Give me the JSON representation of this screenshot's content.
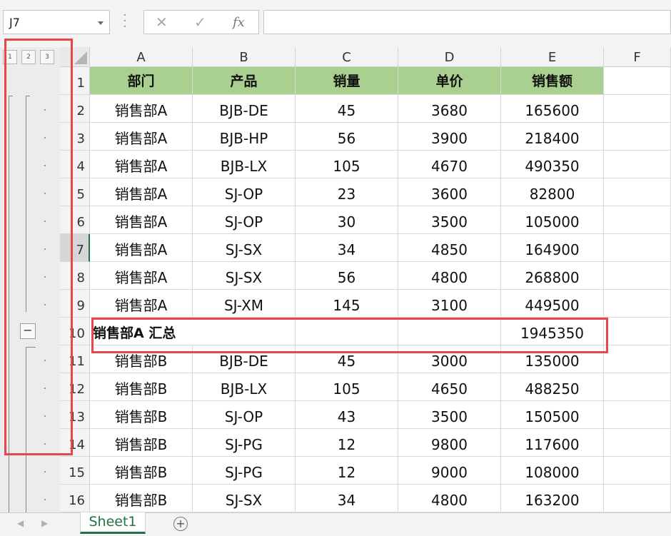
{
  "name_box": {
    "value": "J7"
  },
  "formula_bar": {
    "cancel_icon": "✕",
    "enter_icon": "✓",
    "fx_label": "fx",
    "content": ""
  },
  "outline": {
    "levels": [
      "1",
      "2",
      "3"
    ],
    "collapse_symbol": "−"
  },
  "columns": [
    "A",
    "B",
    "C",
    "D",
    "E",
    "F"
  ],
  "rows": [
    {
      "num": "1",
      "cells": [
        "部门",
        "产品",
        "销量",
        "单价",
        "销售额"
      ],
      "type": "header"
    },
    {
      "num": "2",
      "cells": [
        "销售部A",
        "BJB-DE",
        "45",
        "3680",
        "165600"
      ]
    },
    {
      "num": "3",
      "cells": [
        "销售部A",
        "BJB-HP",
        "56",
        "3900",
        "218400"
      ]
    },
    {
      "num": "4",
      "cells": [
        "销售部A",
        "BJB-LX",
        "105",
        "4670",
        "490350"
      ]
    },
    {
      "num": "5",
      "cells": [
        "销售部A",
        "SJ-OP",
        "23",
        "3600",
        "82800"
      ]
    },
    {
      "num": "6",
      "cells": [
        "销售部A",
        "SJ-OP",
        "30",
        "3500",
        "105000"
      ]
    },
    {
      "num": "7",
      "cells": [
        "销售部A",
        "SJ-SX",
        "34",
        "4850",
        "164900"
      ],
      "selected": true
    },
    {
      "num": "8",
      "cells": [
        "销售部A",
        "SJ-SX",
        "56",
        "4800",
        "268800"
      ]
    },
    {
      "num": "9",
      "cells": [
        "销售部A",
        "SJ-XM",
        "145",
        "3100",
        "449500"
      ]
    },
    {
      "num": "10",
      "cells": [
        "销售部A 汇总",
        "",
        "",
        "",
        "1945350"
      ],
      "type": "subtotal"
    },
    {
      "num": "11",
      "cells": [
        "销售部B",
        "BJB-DE",
        "45",
        "3000",
        "135000"
      ]
    },
    {
      "num": "12",
      "cells": [
        "销售部B",
        "BJB-LX",
        "105",
        "4650",
        "488250"
      ]
    },
    {
      "num": "13",
      "cells": [
        "销售部B",
        "SJ-OP",
        "43",
        "3500",
        "150500"
      ]
    },
    {
      "num": "14",
      "cells": [
        "销售部B",
        "SJ-PG",
        "12",
        "9800",
        "117600"
      ]
    },
    {
      "num": "15",
      "cells": [
        "销售部B",
        "SJ-PG",
        "12",
        "9000",
        "108000"
      ]
    },
    {
      "num": "16",
      "cells": [
        "销售部B",
        "SJ-SX",
        "34",
        "4800",
        "163200"
      ]
    }
  ],
  "sheet_tabs": {
    "active": "Sheet1",
    "add_symbol": "+"
  },
  "colors": {
    "header_fill": "#a9d08e",
    "highlight": "#e8464a",
    "accent": "#217346"
  }
}
